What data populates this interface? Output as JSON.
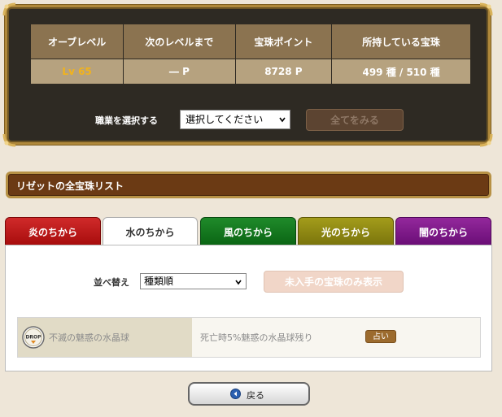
{
  "stats": {
    "headers": [
      "オーブレベル",
      "次のレベルまで",
      "宝珠ポイント",
      "所持している宝珠"
    ],
    "values": [
      "Lv 65",
      "― P",
      "8728 P",
      "499 種 / 510 種"
    ]
  },
  "job": {
    "label": "職業を選択する",
    "select_value": "選択してください",
    "show_all_label": "全てをみる"
  },
  "section": {
    "title": "リゼットの全宝珠リスト"
  },
  "tabs": [
    "炎のちから",
    "水のちから",
    "風のちから",
    "光のちから",
    "闇のちから"
  ],
  "sort": {
    "label": "並べ替え",
    "select_value": "種類順",
    "only_unobtained_label": "未入手の宝珠のみ表示"
  },
  "orb": {
    "icon_text": "DROP",
    "name": "不滅の魅惑の水晶球",
    "effect": "死亡時5%魅惑の水晶球残り",
    "fortune_label": "占い"
  },
  "back": {
    "label": "戻る"
  },
  "colors": {
    "accent_gold": "#f2b31b",
    "fire": "#c21f1f",
    "wind": "#137a1f",
    "light": "#8f8812",
    "dark": "#80188b",
    "section_bg": "#6b3a14"
  }
}
